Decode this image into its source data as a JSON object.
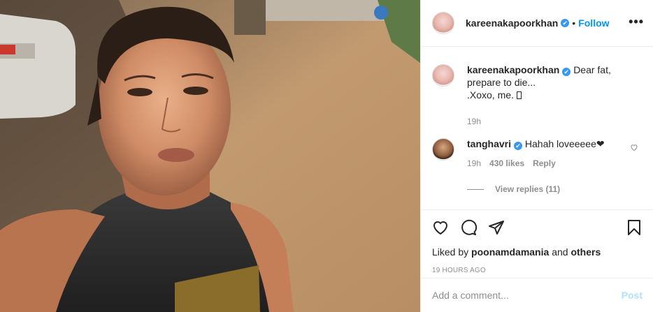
{
  "post": {
    "photo_icon": "selfie-photo",
    "header": {
      "username": "kareenakapoorkhan",
      "verified": "✔",
      "separator": "•",
      "follow_label": "Follow",
      "more_label": "•••"
    },
    "caption": {
      "username": "kareenakapoorkhan",
      "verified": "✔",
      "text_line1": "Dear fat,",
      "text_line2": "prepare to die...",
      "text_line3": ".Xoxo, me. ",
      "time": "19h"
    },
    "comment": {
      "username": "tanghavri",
      "verified": "✔",
      "text": "Hahah loveeeee❤",
      "time": "19h",
      "likes": "430 likes",
      "reply_label": "Reply",
      "view_replies": "View replies (11)"
    },
    "actions": {
      "liked_prefix": "Liked by",
      "liked_user": "poonamdamania",
      "liked_and": "and",
      "liked_others": "others",
      "timestamp": "19 HOURS AGO"
    },
    "add_comment": {
      "placeholder": "Add a comment...",
      "post_label": "Post"
    }
  }
}
